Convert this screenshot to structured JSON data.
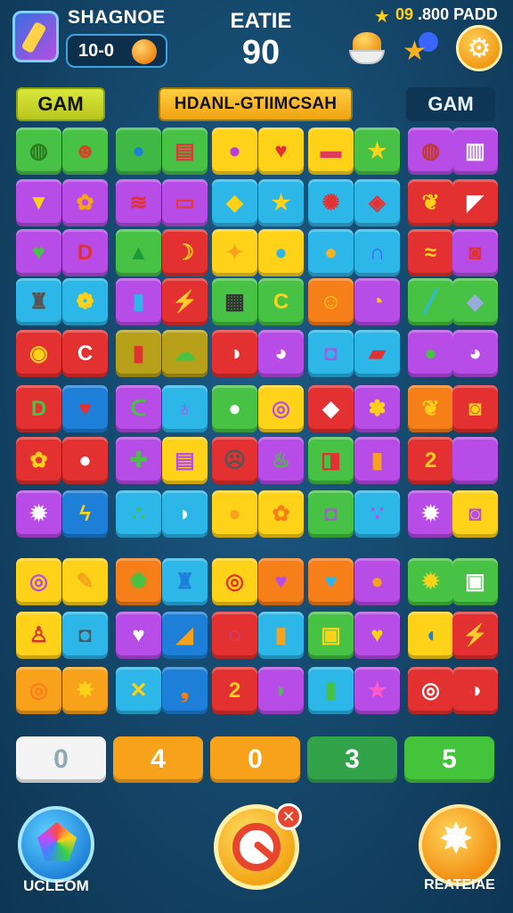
{
  "header": {
    "player_name": "SHAGNOE",
    "score": "10-0",
    "center_label": "EATIE",
    "center_value": "90",
    "currency": "09",
    "currency_extra": ".800 PADD"
  },
  "sections": {
    "left": "GAM",
    "middle": "HDANL-GTIIMCSAH",
    "right": "GAM"
  },
  "score_tiles": [
    {
      "value": "0",
      "color": "#f4f4f4",
      "text_color": "#8fa9b5"
    },
    {
      "value": "4",
      "color": "#f7a21a",
      "text_color": "#ffffff"
    },
    {
      "value": "0",
      "color": "#f7a21a",
      "text_color": "#ffffff"
    },
    {
      "value": "3",
      "color": "#33a34a",
      "text_color": "#ffffff"
    },
    {
      "value": "5",
      "color": "#43c43a",
      "text_color": "#ffffff"
    }
  ],
  "buttons": {
    "left_label": "UCLEOM",
    "right_label": "REATEIAE",
    "center_badge": "✕"
  },
  "tile_rows": [
    [
      [
        "#47c244",
        "◍",
        "#2a7a1f"
      ],
      [
        "#47c244",
        "☻",
        "#d8432a"
      ],
      [
        "#3fb846",
        "●",
        "#1d7fd8"
      ],
      [
        "#47c244",
        "▤",
        "#d93a3a"
      ],
      [
        "#ffd21a",
        "●",
        "#b83ee0"
      ],
      [
        "#ffd21a",
        "♥",
        "#e33030"
      ],
      [
        "#ffd21a",
        "▬",
        "#e03a5a"
      ],
      [
        "#47c244",
        "★",
        "#ffd21a"
      ],
      [
        "#b74ce6",
        "◍",
        "#c0392b"
      ],
      [
        "#b74ce6",
        "▥",
        "#fff"
      ]
    ],
    [
      [
        "#b74ce6",
        "▼",
        "#ffd21a"
      ],
      [
        "#b74ce6",
        "✿",
        "#f7a21a"
      ],
      [
        "#b74ce6",
        "≋",
        "#e33030"
      ],
      [
        "#b74ce6",
        "▭",
        "#e03a3a"
      ],
      [
        "#2cb7e8",
        "◆",
        "#ffd21a"
      ],
      [
        "#2cb7e8",
        "★",
        "#ffd21a"
      ],
      [
        "#2cb7e8",
        "✺",
        "#e33030"
      ],
      [
        "#2cb7e8",
        "◈",
        "#e33030"
      ],
      [
        "#e33030",
        "❦",
        "#ffd21a"
      ],
      [
        "#e33030",
        "◤",
        "#fff"
      ]
    ],
    [
      [
        "#b74ce6",
        "♥",
        "#47c244"
      ],
      [
        "#b74ce6",
        "D",
        "#e33030"
      ],
      [
        "#47c244",
        "▲",
        "#1d9b3a"
      ],
      [
        "#e33030",
        "☽",
        "#ffd21a"
      ],
      [
        "#ffd21a",
        "✦",
        "#f7a21a"
      ],
      [
        "#ffd21a",
        "●",
        "#2cb7e8"
      ],
      [
        "#2cb7e8",
        "●",
        "#ffb020"
      ],
      [
        "#2cb7e8",
        "∩",
        "#3a66ff"
      ],
      [
        "#e33030",
        "≈",
        "#ffd21a"
      ],
      [
        "#b74ce6",
        "◙",
        "#e33030"
      ]
    ],
    [
      [
        "#2cb7e8",
        "♜",
        "#555"
      ],
      [
        "#2cb7e8",
        "❁",
        "#ffd21a"
      ],
      [
        "#b74ce6",
        "▮",
        "#2cb7e8"
      ],
      [
        "#e33030",
        "⚡",
        "#fff"
      ],
      [
        "#47c244",
        "▦",
        "#333"
      ],
      [
        "#47c244",
        "C",
        "#ffd21a"
      ],
      [
        "#f77f1a",
        "☺",
        "#ffd21a"
      ],
      [
        "#b74ce6",
        "◔",
        "#ffd21a"
      ],
      [
        "#47c244",
        "╱",
        "#2cb7e8"
      ],
      [
        "#47c244",
        "◆",
        "#9ad"
      ]
    ],
    [
      [
        "#e33030",
        "◉",
        "#ffd21a"
      ],
      [
        "#e33030",
        "C",
        "#fff"
      ],
      [
        "#b7a11a",
        "▮",
        "#e33030"
      ],
      [
        "#b7a11a",
        "☁",
        "#47c244"
      ],
      [
        "#e33030",
        "◑",
        "#fff"
      ],
      [
        "#b74ce6",
        "◕",
        "#fff"
      ],
      [
        "#2cb7e8",
        "◘",
        "#b74ce6"
      ],
      [
        "#2cb7e8",
        "▰",
        "#e33030"
      ],
      [
        "#b74ce6",
        "●",
        "#47c244"
      ],
      [
        "#b74ce6",
        "◕",
        "#fff"
      ]
    ],
    [
      [
        "#e33030",
        "D",
        "#47c244"
      ],
      [
        "#1d7fd8",
        "♥",
        "#e33030"
      ],
      [
        "#b74ce6",
        "ᑕ",
        "#47c244"
      ],
      [
        "#2cb7e8",
        "♁",
        "#b74ce6"
      ],
      [
        "#47c244",
        "●",
        "#fff"
      ],
      [
        "#ffd21a",
        "◎",
        "#b74ce6"
      ],
      [
        "#e33030",
        "◆",
        "#fff"
      ],
      [
        "#b74ce6",
        "✽",
        "#ffd21a"
      ],
      [
        "#f77f1a",
        "❦",
        "#ffd21a"
      ],
      [
        "#e33030",
        "◙",
        "#ffd21a"
      ]
    ],
    [
      [
        "#e33030",
        "✿",
        "#ffd21a"
      ],
      [
        "#e33030",
        "●",
        "#fff"
      ],
      [
        "#b74ce6",
        "✚",
        "#47c244"
      ],
      [
        "#ffd21a",
        "▤",
        "#b74ce6"
      ],
      [
        "#e33030",
        "☹",
        "#555"
      ],
      [
        "#b74ce6",
        "♨",
        "#47c244"
      ],
      [
        "#47c244",
        "◨",
        "#e33030"
      ],
      [
        "#b74ce6",
        "▮",
        "#f7a21a"
      ],
      [
        "#e33030",
        "2",
        "#ffd21a"
      ],
      [
        "#b74ce6",
        "●",
        "#b74ce6"
      ]
    ],
    [
      [
        "#b74ce6",
        "✹",
        "#fff"
      ],
      [
        "#1d7fd8",
        "ϟ",
        "#ffd21a"
      ],
      [
        "#2cb7e8",
        "∴",
        "#47c244"
      ],
      [
        "#2cb7e8",
        "◗",
        "#fff"
      ],
      [
        "#ffd21a",
        "●",
        "#f7a21a"
      ],
      [
        "#ffd21a",
        "✿",
        "#f77f1a"
      ],
      [
        "#47c244",
        "◘",
        "#b74ce6"
      ],
      [
        "#2cb7e8",
        "∵",
        "#b74ce6"
      ],
      [
        "#b74ce6",
        "✹",
        "#fff"
      ],
      [
        "#ffd21a",
        "◙",
        "#b74ce6"
      ]
    ],
    [
      [
        "#ffd21a",
        "◎",
        "#b74ce6"
      ],
      [
        "#ffd21a",
        "✎",
        "#f7a21a"
      ],
      [
        "#f77f1a",
        "✺",
        "#47c244"
      ],
      [
        "#2cb7e8",
        "♜",
        "#1d7fd8"
      ],
      [
        "#ffd21a",
        "◎",
        "#e33030"
      ],
      [
        "#f77f1a",
        "♥",
        "#b74ce6"
      ],
      [
        "#f77f1a",
        "♥",
        "#2cb7e8"
      ],
      [
        "#b74ce6",
        "●",
        "#f7a21a"
      ],
      [
        "#47c244",
        "✹",
        "#ffd21a"
      ],
      [
        "#47c244",
        "▣",
        "#fff"
      ]
    ],
    [
      [
        "#ffd21a",
        "♙",
        "#e33030"
      ],
      [
        "#2cb7e8",
        "◘",
        "#555"
      ],
      [
        "#b74ce6",
        "♥",
        "#fff"
      ],
      [
        "#1d7fd8",
        "◢",
        "#f7a21a"
      ],
      [
        "#e33030",
        "◌",
        "#b74ce6"
      ],
      [
        "#2cb7e8",
        "▮",
        "#f7a21a"
      ],
      [
        "#47c244",
        "▣",
        "#ffd21a"
      ],
      [
        "#b74ce6",
        "♥",
        "#ffd21a"
      ],
      [
        "#ffd21a",
        "◖",
        "#1d7fd8"
      ],
      [
        "#e33030",
        "⚡",
        "#fff"
      ]
    ],
    [
      [
        "#f7a21a",
        "◎",
        "#f77f1a"
      ],
      [
        "#f7a21a",
        "✸",
        "#ffd21a"
      ],
      [
        "#2cb7e8",
        "✕",
        "#ffd21a"
      ],
      [
        "#1d7fd8",
        "❟",
        "#f77f1a"
      ],
      [
        "#e33030",
        "2",
        "#ffd21a"
      ],
      [
        "#b74ce6",
        "◗",
        "#47c244"
      ],
      [
        "#2cb7e8",
        "▮",
        "#47c244"
      ],
      [
        "#b74ce6",
        "★",
        "#ff5ac8"
      ],
      [
        "#e33030",
        "◎",
        "#fff"
      ],
      [
        "#e33030",
        "◑",
        "#fff"
      ]
    ]
  ]
}
